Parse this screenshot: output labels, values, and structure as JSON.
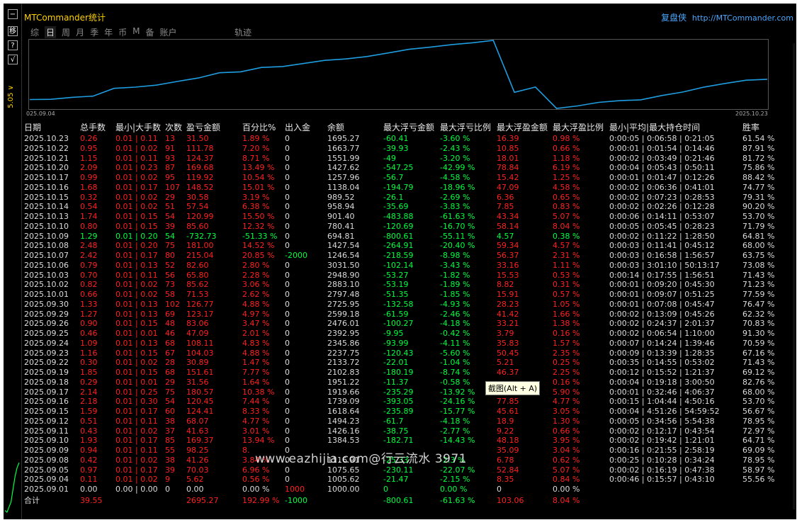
{
  "left_strip": {
    "buttons": [
      "−",
      "移",
      "?",
      "√"
    ],
    "price_label": "5.05 ∨"
  },
  "header": {
    "app_title": "MTCommander统计",
    "brand": "复盘侠",
    "brand_link": "http://MTCommander.com"
  },
  "tabs": [
    {
      "label": "综",
      "active": false
    },
    {
      "label": "日",
      "active": true
    },
    {
      "label": "周",
      "active": false
    },
    {
      "label": "月",
      "active": false
    },
    {
      "label": "季",
      "active": false
    },
    {
      "label": "年",
      "active": false
    },
    {
      "label": "币",
      "active": false
    },
    {
      "label": "M",
      "active": false
    },
    {
      "label": "备",
      "active": false
    },
    {
      "label": "账户",
      "active": false
    }
  ],
  "tab_trace": "轨迹",
  "chart_data": [
    {
      "type": "line",
      "x_start_label": "025.09.04",
      "x_end_label": "2025.10.23",
      "series": [
        {
          "values": [
            1000,
            1005.62,
            1075.65,
            1116.91,
            1384.53,
            1426.16,
            1494.23,
            1618.64,
            1739.09,
            1919.66,
            1951.22,
            2102.83,
            2133.72,
            2237.75,
            2345.86,
            2392.95,
            2476.01,
            2599.18,
            2725.95,
            2797.48,
            2883.1,
            2948.9,
            3031.5,
            1246.54,
            1427.54,
            694.81,
            780.41,
            901.4,
            958.94,
            989.52,
            1138.04,
            1257.96,
            1427.62,
            1551.99,
            1663.77,
            1695.27
          ]
        }
      ],
      "color": "#1e9de0"
    },
    {
      "type": "line",
      "series": [
        {
          "values": [
            10,
            8,
            14,
            20,
            35,
            50,
            60,
            66
          ]
        }
      ],
      "color": "#00ff40"
    }
  ],
  "colors": {
    "loss": "#ff2020",
    "profit": "#00ff40",
    "neutral": "#dcdcdc",
    "accent": "#ffd200"
  },
  "table": {
    "headers": [
      "日期",
      "总手数",
      "最小|大手数",
      "次数",
      "盈亏金额",
      "百分比%",
      "出入金",
      "余额",
      "最大浮亏金额",
      "最大浮亏比例",
      "最大浮盈金额",
      "最大浮盈比例",
      "最小|平均|最大持仓时间",
      "胜率"
    ],
    "rows": [
      {
        "cells": [
          "2025.10.23",
          "0.26",
          "0.01 | 0.11",
          "13",
          "31.50",
          "1.89 %",
          "0",
          "1695.27",
          "-60.41",
          "-3.60 %",
          "16.39",
          "0.98 %",
          "0:00:05 | 0:06:58 | 0:21:05",
          "61.54 %"
        ],
        "tone": "red"
      },
      {
        "cells": [
          "2025.10.22",
          "0.95",
          "0.01 | 0.02",
          "91",
          "111.78",
          "7.20 %",
          "0",
          "1663.77",
          "-39.93",
          "-2.43 %",
          "10.85",
          "0.66 %",
          "0:00:01 | 0:01:54 | 0:14:46",
          "87.91 %"
        ],
        "tone": "red"
      },
      {
        "cells": [
          "2025.10.21",
          "1.15",
          "0.01 | 0.11",
          "93",
          "124.37",
          "8.71 %",
          "0",
          "1551.99",
          "-49",
          "-3.20 %",
          "18.01",
          "1.18 %",
          "0:00:02 | 0:03:49 | 0:21:46",
          "81.72 %"
        ],
        "tone": "red"
      },
      {
        "cells": [
          "2025.10.20",
          "2.09",
          "0.01 | 0.23",
          "87",
          "169.68",
          "13.49 %",
          "0",
          "1427.62",
          "-547.25",
          "-42.99 %",
          "78.84",
          "6.19 %",
          "0:00:04 | 0:05:43 | 0:50:11",
          "75.86 %"
        ],
        "tone": "red"
      },
      {
        "cells": [
          "2025.10.17",
          "0.99",
          "0.01 | 0.02",
          "95",
          "119.92",
          "10.54 %",
          "0",
          "1257.96",
          "-56.7",
          "-4.58 %",
          "15.42",
          "1.25 %",
          "0:00:01 | 0:01:47 | 0:12:26",
          "88.42 %"
        ],
        "tone": "red"
      },
      {
        "cells": [
          "2025.10.16",
          "1.68",
          "0.01 | 0.17",
          "107",
          "148.52",
          "15.01 %",
          "0",
          "1138.04",
          "-194.79",
          "-18.96 %",
          "47.09",
          "4.58 %",
          "0:00:02 | 0:06:36 | 0:41:01",
          "74.77 %"
        ],
        "tone": "red"
      },
      {
        "cells": [
          "2025.10.15",
          "0.32",
          "0.01 | 0.02",
          "29",
          "30.58",
          "3.19 %",
          "0",
          "989.52",
          "-26.1",
          "-2.69 %",
          "6.36",
          "0.65 %",
          "0:00:02 | 0:07:23 | 0:28:53",
          "79.31 %"
        ],
        "tone": "red"
      },
      {
        "cells": [
          "2025.10.14",
          "0.54",
          "0.01 | 0.02",
          "51",
          "57.54",
          "6.38 %",
          "0",
          "958.94",
          "-35.69",
          "-3.83 %",
          "7.85",
          "0.83 %",
          "0:00:02 | 0:02:26 | 0:12:28",
          "90.20 %"
        ],
        "tone": "red"
      },
      {
        "cells": [
          "2025.10.13",
          "1.74",
          "0.01 | 0.15",
          "54",
          "120.99",
          "15.50 %",
          "0",
          "901.40",
          "-483.88",
          "-61.63 %",
          "43.34",
          "5.07 %",
          "0:00:06 | 0:14:11 | 0:53:07",
          "53.70 %"
        ],
        "tone": "red"
      },
      {
        "cells": [
          "2025.10.10",
          "0.80",
          "0.01 | 0.15",
          "39",
          "85.60",
          "12.32 %",
          "0",
          "780.41",
          "-120.69",
          "-16.70 %",
          "58.14",
          "8.04 %",
          "0:00:05 | 0:05:45 | 0:28:23",
          "71.79 %"
        ],
        "tone": "red"
      },
      {
        "cells": [
          "2025.10.09",
          "1.29",
          "0.01 | 0.20",
          "54",
          "-732.73",
          "-51.33 %",
          "0",
          "694.81",
          "-800.61",
          "-55.11 %",
          "4.57",
          "0.38 %",
          "0:00:02 | 0:11:22 | 1:28:50",
          "64.81 %"
        ],
        "tone": "grn"
      },
      {
        "cells": [
          "2025.10.08",
          "2.48",
          "0.01 | 0.20",
          "75",
          "181.00",
          "14.52 %",
          "0",
          "1427.54",
          "-264.91",
          "-20.40 %",
          "59.34",
          "4.57 %",
          "0:00:03 | 0:11:41 | 0:45:12",
          "68.00 %"
        ],
        "tone": "red"
      },
      {
        "cells": [
          "2025.10.07",
          "2.42",
          "0.01 | 0.17",
          "80",
          "215.04",
          "20.85 %",
          "-2000",
          "1246.54",
          "-218.59",
          "-8.98 %",
          "56.37",
          "2.31 %",
          "0:00:03 | 0:16:58 | 1:56:57",
          "63.75 %"
        ],
        "tone": "red",
        "inout_tone": "grn"
      },
      {
        "cells": [
          "2025.10.06",
          "0.79",
          "0.01 | 0.13",
          "52",
          "82.60",
          "2.80 %",
          "0",
          "3031.50",
          "-102.14",
          "-3.43 %",
          "33.16",
          "1.11 %",
          "0:00:03 | 3:01:10 | 50:13:17",
          "73.08 %"
        ],
        "tone": "red"
      },
      {
        "cells": [
          "2025.10.03",
          "0.70",
          "0.01 | 0.11",
          "56",
          "65.80",
          "2.28 %",
          "0",
          "2948.90",
          "-53.27",
          "-1.82 %",
          "15.53",
          "0.53 %",
          "0:00:14 | 0:17:55 | 1:56:51",
          "71.43 %"
        ],
        "tone": "red"
      },
      {
        "cells": [
          "2025.10.02",
          "0.82",
          "0.01 | 0.02",
          "73",
          "85.62",
          "3.06 %",
          "0",
          "2883.10",
          "-53.19",
          "-1.89 %",
          "8.82",
          "0.31 %",
          "0:00:01 | 0:09:20 | 0:45:30",
          "71.23 %"
        ],
        "tone": "red"
      },
      {
        "cells": [
          "2025.10.01",
          "0.66",
          "0.01 | 0.02",
          "58",
          "71.53",
          "2.62 %",
          "0",
          "2797.48",
          "-51.35",
          "-1.85 %",
          "15.91",
          "0.57 %",
          "0:00:01 | 0:09:07 | 0:51:25",
          "77.59 %"
        ],
        "tone": "red"
      },
      {
        "cells": [
          "2025.09.30",
          "1.33",
          "0.01 | 0.13",
          "102",
          "126.77",
          "4.88 %",
          "0",
          "2725.95",
          "-132.58",
          "-4.93 %",
          "28.23",
          "1.05 %",
          "0:00:01 | 0:07:08 | 0:45:47",
          "76.47 %"
        ],
        "tone": "red"
      },
      {
        "cells": [
          "2025.09.29",
          "1.27",
          "0.01 | 0.13",
          "69",
          "123.17",
          "4.97 %",
          "0",
          "2599.18",
          "-61.59",
          "-2.46 %",
          "41.42",
          "1.66 %",
          "0:00:02 | 0:13:09 | 0:45:26",
          "62.32 %"
        ],
        "tone": "red"
      },
      {
        "cells": [
          "2025.09.26",
          "0.90",
          "0.01 | 0.15",
          "48",
          "83.06",
          "3.47 %",
          "0",
          "2476.01",
          "-100.27",
          "-4.18 %",
          "33.21",
          "1.38 %",
          "0:00:02 | 0:24:37 | 2:01:37",
          "70.83 %"
        ],
        "tone": "red"
      },
      {
        "cells": [
          "2025.09.25",
          "0.46",
          "0.01 | 0.01",
          "46",
          "47.09",
          "2.01 %",
          "0",
          "2392.95",
          "-9.95",
          "-0.42 %",
          "3.79",
          "0.16 %",
          "0:00:02 | 0:06:54 | 1:10:00",
          "91.30 %"
        ],
        "tone": "red"
      },
      {
        "cells": [
          "2025.09.24",
          "1.09",
          "0.01 | 0.13",
          "68",
          "108.11",
          "4.83 %",
          "0",
          "2345.86",
          "-93.99",
          "-4.11 %",
          "35.83",
          "1.57 %",
          "0:00:07 | 0:14:24 | 1:39:46",
          "70.59 %"
        ],
        "tone": "red"
      },
      {
        "cells": [
          "2025.09.23",
          "1.16",
          "0.01 | 0.15",
          "67",
          "104.03",
          "4.88 %",
          "0",
          "2237.75",
          "-120.43",
          "-5.60 %",
          "50.45",
          "2.35 %",
          "0:00:09 | 0:13:39 | 1:28:35",
          "67.16 %"
        ],
        "tone": "red"
      },
      {
        "cells": [
          "2025.09.22",
          "0.30",
          "0.01 | 0.02",
          "28",
          "30.89",
          "1.47 %",
          "0",
          "2133.72",
          "-22.01",
          "-1.04 %",
          "5.21",
          "0.25 %",
          "0:00:35 | 0:14:55 | 0:53:02",
          "71.43 %"
        ],
        "tone": "red"
      },
      {
        "cells": [
          "2025.09.19",
          "1.85",
          "0.01 | 0.15",
          "68",
          "151.61",
          "7.77 %",
          "0",
          "2102.83",
          "-180.19",
          "-8.74 %",
          "46.37",
          "2.25 %",
          "0:00:12 | 0:15:52 | 1:21:37",
          "69.12 %"
        ],
        "tone": "red"
      },
      {
        "cells": [
          "2025.09.18",
          "0.29",
          "0.01 | 0.01",
          "29",
          "31.56",
          "1.64 %",
          "0",
          "1951.22",
          "-11.37",
          "-0.58 %",
          "",
          "0.16 %",
          "0:00:04 | 0:19:18 | 3:00:50",
          "82.76 %"
        ],
        "tone": "red"
      },
      {
        "cells": [
          "2025.09.17",
          "2.14",
          "0.01 | 0.25",
          "75",
          "180.57",
          "10.38 %",
          "0",
          "1919.66",
          "-235.29",
          "-13.92 %",
          "",
          "5.90 %",
          "0:00:01 | 0:32:46 | 4:06:37",
          "68.00 %"
        ],
        "tone": "red"
      },
      {
        "cells": [
          "2025.09.16",
          "2.18",
          "0.01 | 0.30",
          "54",
          "120.45",
          "7.44 %",
          "0",
          "1739.09",
          "-393.05",
          "-24.16 %",
          "77.85",
          "4.77 %",
          "0:00:15 | 1:04:44 | 4:50:16",
          "53.70 %"
        ],
        "tone": "red"
      },
      {
        "cells": [
          "2025.09.15",
          "1.59",
          "0.01 | 0.17",
          "60",
          "124.41",
          "8.33 %",
          "0",
          "1618.64",
          "-235.89",
          "-15.77 %",
          "45.61",
          "3.05 %",
          "0:00:04 | 4:51:26 | 54:59:52",
          "56.67 %"
        ],
        "tone": "red"
      },
      {
        "cells": [
          "2025.09.12",
          "0.51",
          "0.01 | 0.11",
          "38",
          "68.07",
          "4.77 %",
          "0",
          "1494.23",
          "-61.7",
          "-4.18 %",
          "18.9",
          "1.30 %",
          "0:00:05 | 0:34:56 | 5:54:38",
          "78.95 %"
        ],
        "tone": "red"
      },
      {
        "cells": [
          "2025.09.11",
          "0.43",
          "0.01 | 0.02",
          "37",
          "41.63",
          "3.01 %",
          "0",
          "1426.16",
          "-38.75",
          "-2.77 %",
          "9.22",
          "0.66 %",
          "0:00:02 | 0:12:17 | 0:43:54",
          "72.97 %"
        ],
        "tone": "red"
      },
      {
        "cells": [
          "2025.09.10",
          "1.93",
          "0.01 | 0.17",
          "85",
          "169.37",
          "13.94 %",
          "0",
          "1384.53",
          "-182.71",
          "-14.43 %",
          "48.18",
          "3.95 %",
          "0:00:02 | 0:19:42 | 1:21:01",
          "64.71 %"
        ],
        "tone": "red"
      },
      {
        "cells": [
          "2025.09.09",
          "0.94",
          "0.01 | 0.11",
          "55",
          "98.25",
          "8.",
          "0",
          "",
          "",
          "",
          "35.09",
          "3.04 %",
          "0:00:16 | 0:21:55 | 2:58:19",
          "69.09 %"
        ],
        "tone": "red"
      },
      {
        "cells": [
          "2025.09.08",
          "0.42",
          "0.01 | 0.02",
          "38",
          "41.26",
          "3.84 %",
          "0",
          "1116.91",
          "-25.33",
          "-2.3 %",
          "6.78",
          "0.62 %",
          "0:00:25 | 0:10:28 | 0:34:24",
          "78.95 %"
        ],
        "tone": "red"
      },
      {
        "cells": [
          "2025.09.05",
          "0.97",
          "0.01 | 0.17",
          "39",
          "70.03",
          "6.96 %",
          "0",
          "1075.65",
          "-230.11",
          "-22.07 %",
          "52.84",
          "5.07 %",
          "0:00:02 | 0:16:19 | 0:47:38",
          "58.97 %"
        ],
        "tone": "red"
      },
      {
        "cells": [
          "2025.09.04",
          "0.11",
          "0.01 | 0.02",
          "9",
          "5.62",
          "0.56 %",
          "0",
          "1005.62",
          "-21.47",
          "-2.15 %",
          "8.35",
          "0.84 %",
          "0:00:46 | 0:15:57 | 0:43:10",
          "55.56 %"
        ],
        "tone": "red"
      },
      {
        "cells": [
          "2025.09.01",
          "0.00",
          "0.00 | 0.00",
          "0",
          "0.00",
          "0.00 %",
          "1000",
          "1000.00",
          "0",
          "0.00 %",
          "0",
          "0.00 %",
          "",
          ""
        ],
        "tone": "wht",
        "inout_tone": "red"
      }
    ],
    "total": {
      "cells": [
        "合计",
        "39.55",
        "",
        "",
        "2695.27",
        "192.99 %",
        "-1000",
        "",
        "-800.61",
        "-61.63 %",
        "103.06",
        "8.04 %",
        "",
        ""
      ]
    }
  },
  "tooltip": "截图(Alt + A)",
  "watermark": "www.eazhijia.com@行云流水 3971"
}
